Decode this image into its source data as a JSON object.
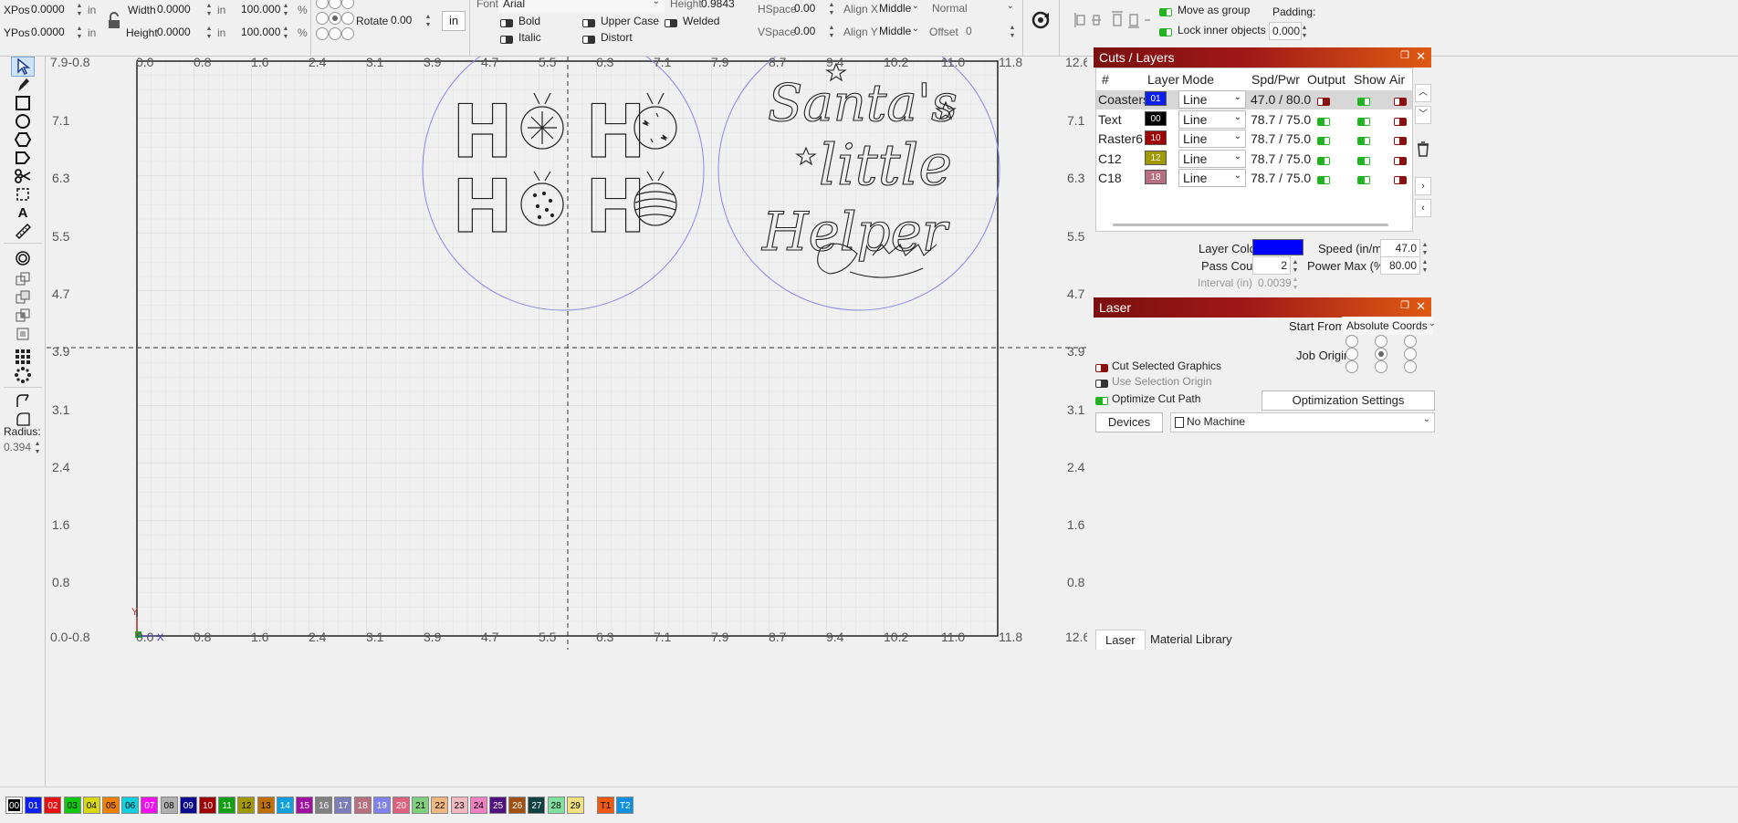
{
  "toolbar": {
    "xpos_label": "XPos",
    "xpos_value": "0.0000",
    "ypos_label": "YPos",
    "ypos_value": "0.0000",
    "unit_in": "in",
    "width_label": "Width",
    "width_value": "0.0000",
    "height_label": "Height",
    "height_value": "0.0000",
    "scale_w": "100.000",
    "scale_h": "100.000",
    "percent": "%",
    "rotate_label": "Rotate",
    "rotate_value": "0.00",
    "units_button": "in",
    "font_label": "Font",
    "font_value": "Arial",
    "font_height_label": "Height",
    "font_height_value": "0.9843",
    "hspace_label": "HSpace",
    "hspace_value": "0.00",
    "vspace_label": "VSpace",
    "vspace_value": "0.00",
    "alignx_label": "Align X",
    "alignx_value": "Middle",
    "aligny_label": "Align Y",
    "aligny_value": "Middle",
    "style_value": "Normal",
    "offset_label": "Offset",
    "offset_value": "0",
    "bold": "Bold",
    "italic": "Italic",
    "upper_case": "Upper Case",
    "distort": "Distort",
    "welded": "Welded",
    "move_as_group": "Move as group",
    "lock_inner": "Lock inner objects",
    "padding_label": "Padding:",
    "padding_value": "0.000"
  },
  "left_tools": {
    "radius_label": "Radius:",
    "radius_value": "0.394"
  },
  "rulers": {
    "top": [
      "0.0",
      "0.8",
      "1.6",
      "2.4",
      "3.1",
      "3.9",
      "4.7",
      "5.5",
      "6.3",
      "7.1",
      "7.9",
      "8.7",
      "9.4",
      "10.2",
      "11.0",
      "11.8"
    ],
    "top_left": "7.9-0.8",
    "top_right": "12.67.9",
    "bottom": [
      "0.0",
      "0.8",
      "1.6",
      "2.4",
      "3.1",
      "3.9",
      "4.7",
      "5.5",
      "6.3",
      "7.1",
      "7.9",
      "8.7",
      "9.4",
      "10.2",
      "11.0",
      "11.8"
    ],
    "bottom_left": "0.0-0.8",
    "bottom_right": "12.60.0",
    "left": [
      "7.1",
      "6.3",
      "5.5",
      "4.7",
      "3.9",
      "3.1",
      "2.4",
      "1.6",
      "0.8"
    ],
    "right": [
      "7.1",
      "6.3",
      "5.5",
      "4.7",
      "3.9",
      "3.1",
      "2.4",
      "1.6",
      "0.8"
    ],
    "axis_x": "X",
    "axis_y": "Y"
  },
  "cuts_layers": {
    "title": "Cuts / Layers",
    "headers": [
      "#",
      "Layer",
      "Mode",
      "Spd/Pwr",
      "Output",
      "Show",
      "Air"
    ],
    "rows": [
      {
        "name": "Coasters",
        "layer": "01",
        "color": "#0a1ff0",
        "mode": "Line",
        "spdpwr": "47.0 / 80.0",
        "output": "red",
        "show": "green",
        "air": "red"
      },
      {
        "name": "Text",
        "layer": "00",
        "color": "#000000",
        "mode": "Line",
        "spdpwr": "78.7 / 75.0",
        "output": "green",
        "show": "green",
        "air": "red"
      },
      {
        "name": "Raster6",
        "layer": "10",
        "color": "#a00000",
        "mode": "Line",
        "spdpwr": "78.7 / 75.0",
        "output": "green",
        "show": "green",
        "air": "red"
      },
      {
        "name": "C12",
        "layer": "12",
        "color": "#a09a00",
        "mode": "Line",
        "spdpwr": "78.7 / 75.0",
        "output": "green",
        "show": "green",
        "air": "red"
      },
      {
        "name": "C18",
        "layer": "18",
        "color": "#b87080",
        "mode": "Line",
        "spdpwr": "78.7 / 75.0",
        "output": "green",
        "show": "green",
        "air": "red"
      }
    ],
    "layer_color_label": "Layer Color",
    "layer_color": "#0000ff",
    "speed_label": "Speed (in/m)",
    "speed_value": "47.0",
    "pass_count_label": "Pass Count",
    "pass_count_value": "2",
    "power_max_label": "Power Max (%)",
    "power_max_value": "80.00",
    "interval_label": "Interval (in)",
    "interval_value": "0.0039"
  },
  "laser": {
    "title": "Laser",
    "start_from_label": "Start From:",
    "start_from_value": "Absolute Coords",
    "job_origin_label": "Job Origin",
    "cut_selected": "Cut Selected Graphics",
    "use_selection_origin": "Use Selection Origin",
    "optimize_cut_path": "Optimize Cut Path",
    "optimization_settings": "Optimization Settings",
    "devices_button": "Devices",
    "machine_value": "No Machine"
  },
  "bottom_tabs": [
    "Laser",
    "Material Library"
  ],
  "canvas_art": {
    "ho_letters": [
      "H",
      "H",
      "H",
      "H"
    ],
    "santa_line1": "Santa's",
    "santa_line2": "little",
    "santa_line3": "Helper"
  },
  "palette": [
    {
      "label": "00",
      "color": "#000000",
      "text": "#ffffff"
    },
    {
      "label": "01",
      "color": "#0a1ff0",
      "text": "#ffffff"
    },
    {
      "label": "02",
      "color": "#e81010",
      "text": "#ffffff"
    },
    {
      "label": "03",
      "color": "#10c810",
      "text": "#000000"
    },
    {
      "label": "04",
      "color": "#d8d810",
      "text": "#000000"
    },
    {
      "label": "05",
      "color": "#f08000",
      "text": "#000000"
    },
    {
      "label": "06",
      "color": "#10d0e0",
      "text": "#000000"
    },
    {
      "label": "07",
      "color": "#f010f0",
      "text": "#ffffff"
    },
    {
      "label": "08",
      "color": "#b0b0b0",
      "text": "#000000"
    },
    {
      "label": "09",
      "color": "#0a0a90",
      "text": "#ffffff"
    },
    {
      "label": "10",
      "color": "#a00000",
      "text": "#ffffff"
    },
    {
      "label": "11",
      "color": "#10a010",
      "text": "#ffffff"
    },
    {
      "label": "12",
      "color": "#a09a00",
      "text": "#000000"
    },
    {
      "label": "13",
      "color": "#c07000",
      "text": "#000000"
    },
    {
      "label": "14",
      "color": "#10a0e0",
      "text": "#ffffff"
    },
    {
      "label": "15",
      "color": "#a010a0",
      "text": "#ffffff"
    },
    {
      "label": "16",
      "color": "#808080",
      "text": "#ffffff"
    },
    {
      "label": "17",
      "color": "#7d7db8",
      "text": "#ffffff"
    },
    {
      "label": "18",
      "color": "#b87080",
      "text": "#ffffff"
    },
    {
      "label": "19",
      "color": "#8080f0",
      "text": "#ffffff"
    },
    {
      "label": "20",
      "color": "#e06080",
      "text": "#ffffff"
    },
    {
      "label": "21",
      "color": "#80d080",
      "text": "#000000"
    },
    {
      "label": "22",
      "color": "#f0b880",
      "text": "#000000"
    },
    {
      "label": "23",
      "color": "#f0b8c0",
      "text": "#000000"
    },
    {
      "label": "24",
      "color": "#f080c0",
      "text": "#000000"
    },
    {
      "label": "25",
      "color": "#501080",
      "text": "#ffffff"
    },
    {
      "label": "26",
      "color": "#a05010",
      "text": "#ffffff"
    },
    {
      "label": "27",
      "color": "#104040",
      "text": "#ffffff"
    },
    {
      "label": "28",
      "color": "#80e0a0",
      "text": "#000000"
    },
    {
      "label": "29",
      "color": "#f0e080",
      "text": "#000000"
    },
    {
      "label": "T1",
      "color": "#f05a10",
      "text": "#000000"
    },
    {
      "label": "T2",
      "color": "#1090e0",
      "text": "#ffffff"
    }
  ]
}
